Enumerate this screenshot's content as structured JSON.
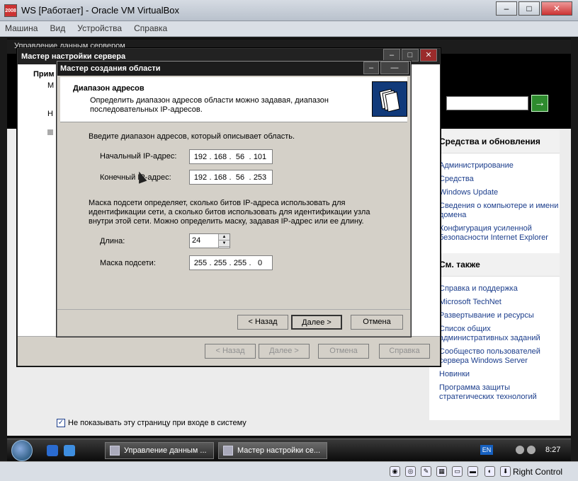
{
  "host": {
    "title": "WS [Работает] - Oracle VM VirtualBox",
    "app_icon_text": "2008",
    "menu": [
      "Машина",
      "Вид",
      "Устройства",
      "Справка"
    ],
    "status_right": "Right Control"
  },
  "server_manager": {
    "title": "Управление данным сервером",
    "left_bold": "Прим",
    "left_sub": "М",
    "left_n": "Н",
    "right_panel": {
      "section1_title": "Средства и обновления",
      "section1_links": [
        "Администрирование",
        "Средства",
        "Windows Update",
        "Сведения о компьютере и имени домена",
        "Конфигурация усиленной безопасности Internet Explorer"
      ],
      "section2_title": "См. также",
      "section2_links": [
        "Справка и поддержка",
        "Microsoft TechNet",
        "Развертывание и ресурсы",
        "Список общих административных заданий",
        "Сообщество пользователей сервера Windows Server",
        "Новинки",
        "Программа защиты стратегических технологий"
      ]
    },
    "dont_show_label": "Не показывать эту страницу при входе в систему",
    "dont_show_checked": true,
    "go_icon": "→"
  },
  "config_wizard": {
    "title": "Мастер настройки сервера",
    "buttons": {
      "back": "< Назад",
      "next": "Далее >",
      "cancel": "Отмена",
      "help": "Справка"
    }
  },
  "scope_wizard": {
    "title": "Мастер создания области",
    "header_title": "Диапазон адресов",
    "header_subtitle": "Определить диапазон адресов области можно задавая, диапазон последовательных IP-адресов.",
    "intro": "Введите диапазон адресов, который описывает область.",
    "start_ip_label": "Начальный IP-адрес:",
    "start_ip": [
      "192",
      "168",
      "56",
      "101"
    ],
    "end_ip_label": "Конечный IP-адрес:",
    "end_ip": [
      "192",
      "168",
      "56",
      "253"
    ],
    "mask_description": "Маска подсети определяет, сколько битов IP-адреса использовать для идентификации сети, а сколько битов использовать для идентификации узла внутри этой сети. Можно определить маску, задавая IP-адрес или ее длину.",
    "length_label": "Длина:",
    "length_value": "24",
    "mask_label": "Маска подсети:",
    "mask_value": [
      "255",
      "255",
      "255",
      "0"
    ],
    "buttons": {
      "back": "< Назад",
      "next": "Далее >",
      "cancel": "Отмена"
    }
  },
  "taskbar": {
    "tasks": [
      "Управление данным ...",
      "Мастер настройки се..."
    ],
    "lang": "EN",
    "time": "8:27"
  }
}
